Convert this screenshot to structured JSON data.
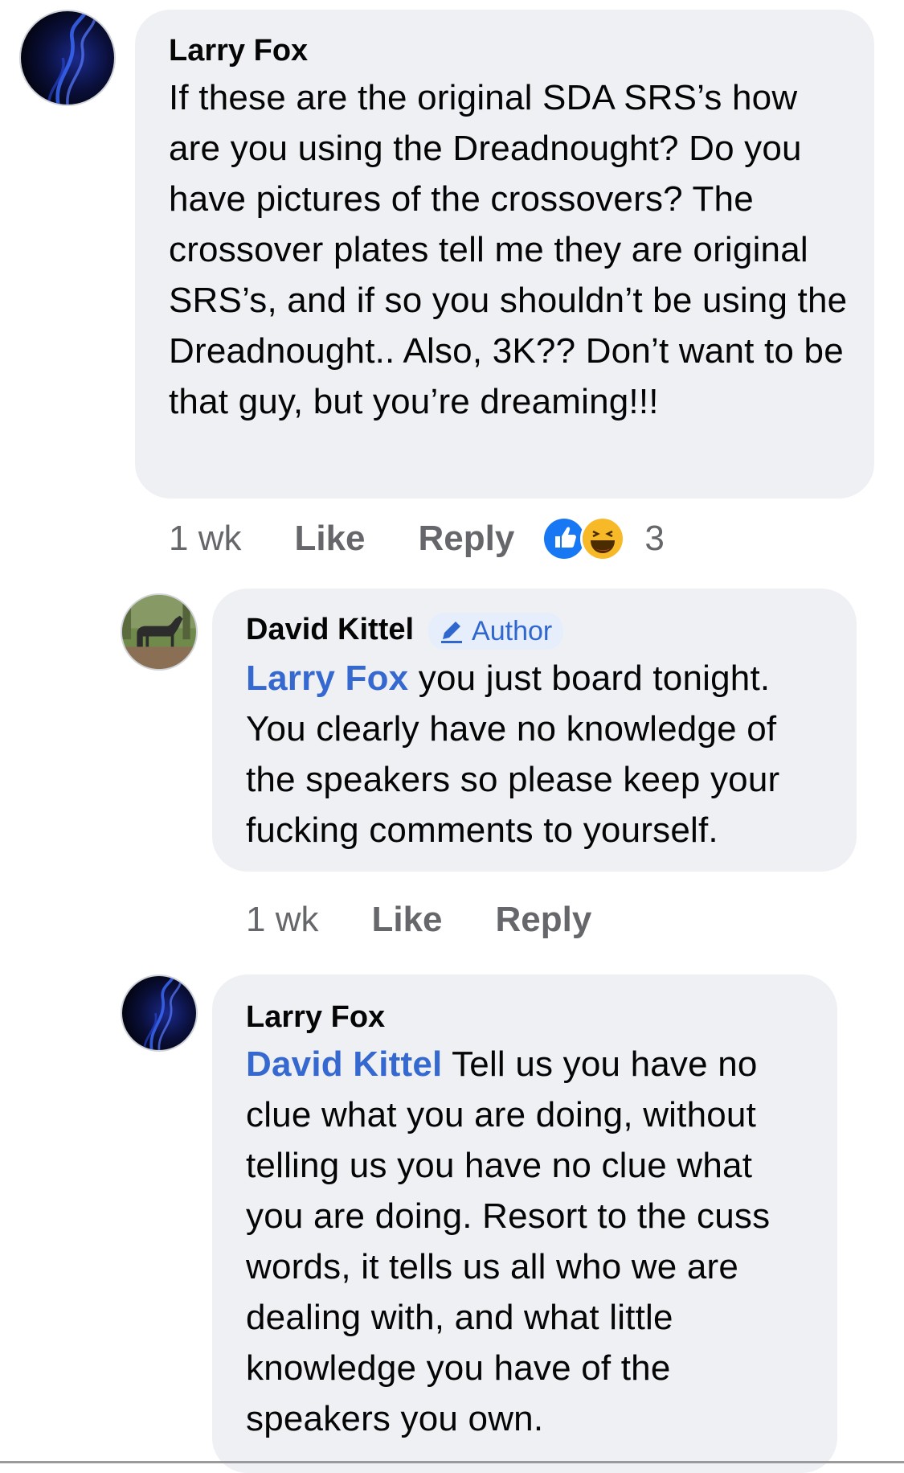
{
  "comments": [
    {
      "author": "Larry Fox",
      "mention": "",
      "text": "If these are the original SDA SRS’s how are you using the Dreadnought? Do you have pictures of the crossovers? The crossover plates tell me they are original SRS’s, and if so you shouldn’t be using the Dreadnought.. Also, 3K?? Don’t want to be that guy, but you’re dreaming!!!",
      "time": "1 wk",
      "like_label": "Like",
      "reply_label": "Reply",
      "reactions": [
        "like-reaction",
        "haha-reaction"
      ],
      "reaction_count": "3"
    },
    {
      "author": "David Kittel",
      "badge": "Author",
      "mention": "Larry Fox",
      "text": " you just board tonight. You clearly have no knowledge of the speakers so please keep your fucking comments to yourself.",
      "time": "1 wk",
      "like_label": "Like",
      "reply_label": "Reply"
    },
    {
      "author": "Larry Fox",
      "mention": "David Kittel",
      "text": " Tell us you have no clue what you are doing, without telling us you have no clue what you are doing. Resort to the cuss words, it tells us all who we are dealing with, and what little knowledge you have of the speakers you own."
    }
  ],
  "colors": {
    "bubble": "#eff0f4",
    "mention": "#3569d0",
    "meta": "#65676b",
    "like_blue": "#1877f2",
    "haha_yellow": "#f7b928"
  }
}
